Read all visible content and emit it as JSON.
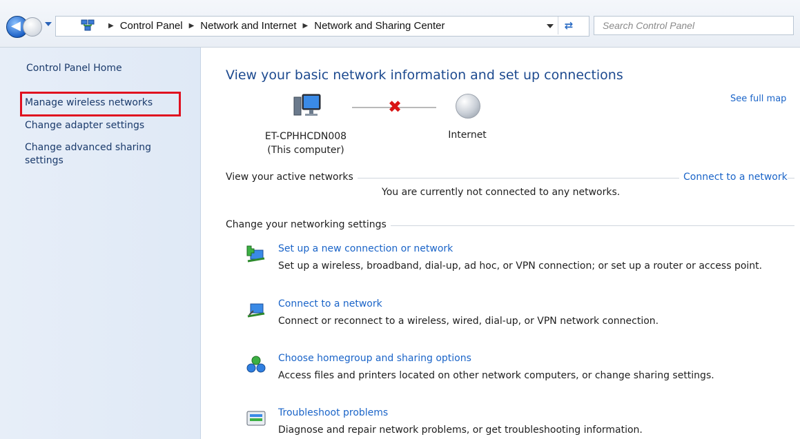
{
  "address_bar": {
    "breadcrumbs": [
      "Control Panel",
      "Network and Internet",
      "Network and Sharing Center"
    ],
    "search_placeholder": "Search Control Panel",
    "icons": [
      "back-arrow-icon",
      "forward-arrow-icon",
      "recent-pages-dropdown-icon",
      "network-folder-icon",
      "chevron-right-icon",
      "refresh-icon"
    ]
  },
  "sidebar": {
    "home": "Control Panel Home",
    "links": [
      "Manage wireless networks",
      "Change adapter settings",
      "Change advanced sharing settings"
    ],
    "highlight_color": "#e0101f"
  },
  "main": {
    "title": "View your basic network information and set up connections",
    "see_full_map": "See full map",
    "computer_name": "ET-CPHHCDN008",
    "computer_sub": "(This computer)",
    "internet_label": "Internet",
    "active_networks_label": "View your active networks",
    "connect_link": "Connect to a network",
    "not_connected": "You are currently not connected to any networks.",
    "change_settings_label": "Change your networking settings",
    "tasks": [
      {
        "icon": "new-connection-icon",
        "link": "Set up a new connection or network",
        "desc": "Set up a wireless, broadband, dial-up, ad hoc, or VPN connection; or set up a router or access point."
      },
      {
        "icon": "connect-network-icon",
        "link": "Connect to a network",
        "desc": "Connect or reconnect to a wireless, wired, dial-up, or VPN network connection."
      },
      {
        "icon": "homegroup-icon",
        "link": "Choose homegroup and sharing options",
        "desc": "Access files and printers located on other network computers, or change sharing settings."
      },
      {
        "icon": "troubleshoot-icon",
        "link": "Troubleshoot problems",
        "desc": "Diagnose and repair network problems, or get troubleshooting information."
      }
    ]
  },
  "colors": {
    "link": "#1a64c8",
    "title": "#1d4a8f",
    "sidebar_bg": "#e3ecf7"
  }
}
